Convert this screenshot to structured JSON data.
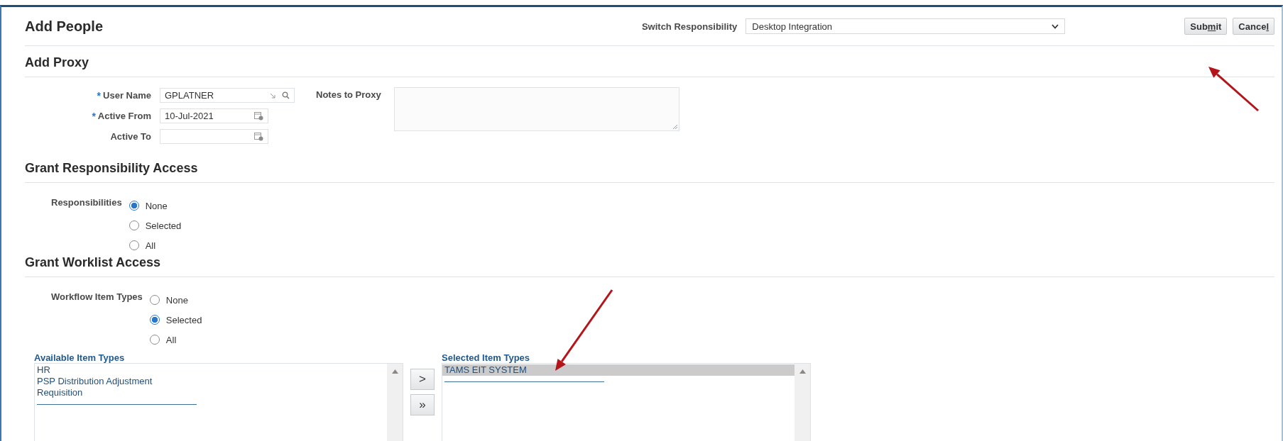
{
  "page_title": "Add People",
  "switch_responsibility": {
    "label": "Switch Responsibility",
    "value": "Desktop Integration"
  },
  "buttons": [
    {
      "before": "Sub",
      "access_key": "m",
      "after": "it"
    },
    {
      "before": "Cance",
      "access_key": "l"
    }
  ],
  "required_symbol": "*",
  "proxy": {
    "title": "Add Proxy",
    "fields": [
      {
        "label": "User Name",
        "required": true,
        "value": "GPLATNER",
        "kind": "lookup"
      },
      {
        "label": "Active From",
        "required": true,
        "value": "10-Jul-2021",
        "kind": "date"
      },
      {
        "label": "Active To",
        "required": false,
        "kind": "date"
      }
    ],
    "notes": {
      "label": "Notes to Proxy"
    }
  },
  "responsibility": {
    "title": "Grant Responsibility Access",
    "label": "Responsibilities",
    "options": [
      {
        "label": "None",
        "selected": true
      },
      {
        "label": "Selected",
        "selected": false
      },
      {
        "label": "All",
        "selected": false
      }
    ]
  },
  "worklist": {
    "title": "Grant Worklist Access",
    "label": "Workflow Item Types",
    "options": [
      {
        "label": "None",
        "selected": false
      },
      {
        "label": "Selected",
        "selected": true
      },
      {
        "label": "All",
        "selected": false
      }
    ],
    "available": {
      "title": "Available Item Types",
      "items": [
        {
          "label": "HR",
          "selected": false
        },
        {
          "label": "PSP Distribution Adjustment",
          "selected": false
        },
        {
          "label": "Requisition",
          "selected": false
        }
      ]
    },
    "move_buttons": [
      ">",
      "»"
    ],
    "selected_list": {
      "title": "Selected Item Types",
      "items": [
        {
          "label": "TAMS EIT SYSTEM",
          "selected": true
        }
      ]
    }
  }
}
